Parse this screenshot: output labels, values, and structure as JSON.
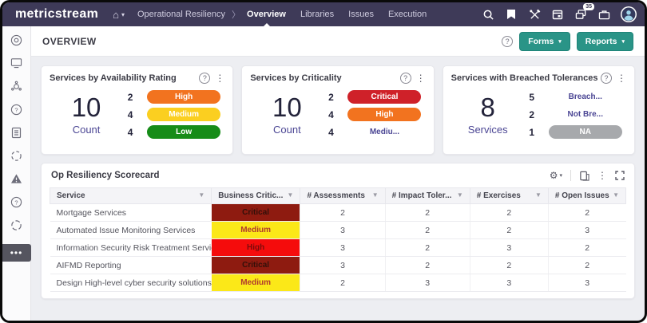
{
  "icons": {
    "home": "⌂",
    "caret": "▾",
    "chevron": "〉",
    "help": "?",
    "kebab": "⋮",
    "gear": "⚙",
    "sort": "▼",
    "more": "•••"
  },
  "topbar": {
    "logo": "metricstream",
    "breadcrumb_parent": "Operational Resiliency",
    "nav_active": "Overview",
    "nav_items": {
      "libraries": "Libraries",
      "issues": "Issues",
      "execution": "Execution"
    },
    "notification_badge": "35"
  },
  "page": {
    "title": "OVERVIEW",
    "forms_button": "Forms",
    "reports_button": "Reports"
  },
  "cards": [
    {
      "title": "Services by Availability Rating",
      "count": "10",
      "count_label": "Count",
      "rows": [
        {
          "value": "2",
          "label": "High",
          "bg": "#f2731f",
          "color": "#ffffff"
        },
        {
          "value": "4",
          "label": "Medium",
          "bg": "#fbcf20",
          "color": "#ffffff"
        },
        {
          "value": "4",
          "label": "Low",
          "bg": "#168c18",
          "color": "#ffffff"
        }
      ]
    },
    {
      "title": "Services by Criticality",
      "count": "10",
      "count_label": "Count",
      "rows": [
        {
          "value": "2",
          "label": "Critical",
          "bg": "#cf2129",
          "color": "#ffffff"
        },
        {
          "value": "4",
          "label": "High",
          "bg": "#f2731f",
          "color": "#ffffff"
        },
        {
          "value": "4",
          "label": "Mediu...",
          "bg": "transparent",
          "color": "#4b4694"
        }
      ]
    },
    {
      "title": "Services with Breached Tolerances",
      "count": "8",
      "count_label": "Services",
      "rows": [
        {
          "value": "5",
          "label": "Breach...",
          "bg": "transparent",
          "color": "#4b4694"
        },
        {
          "value": "2",
          "label": "Not Bre...",
          "bg": "transparent",
          "color": "#4b4694"
        },
        {
          "value": "1",
          "label": "NA",
          "bg": "#a7a9ac",
          "color": "#ffffff"
        }
      ]
    }
  ],
  "scorecard": {
    "title": "Op Resiliency Scorecard",
    "columns": [
      "Service",
      "Business Critic...",
      "# Assessments",
      "# Impact Toler...",
      "# Exercises",
      "# Open Issues"
    ],
    "rows": [
      {
        "service": "Mortgage Services",
        "criticality": "Critical",
        "crit_bg": "#8e1b10",
        "crit_color": "#33100a",
        "assessments": "2",
        "impact": "2",
        "exercises": "2",
        "open_issues": "2"
      },
      {
        "service": "Automated Issue Monitoring Services",
        "criticality": "Medium",
        "crit_bg": "#fbe818",
        "crit_color": "#b03a2e",
        "assessments": "3",
        "impact": "2",
        "exercises": "2",
        "open_issues": "3"
      },
      {
        "service": "Information Security Risk Treatment Service",
        "criticality": "High",
        "crit_bg": "#f50c0c",
        "crit_color": "#7c0b0b",
        "assessments": "3",
        "impact": "2",
        "exercises": "3",
        "open_issues": "2"
      },
      {
        "service": "AIFMD Reporting",
        "criticality": "Critical",
        "crit_bg": "#8e1b10",
        "crit_color": "#33100a",
        "assessments": "3",
        "impact": "2",
        "exercises": "2",
        "open_issues": "2"
      },
      {
        "service": "Design High-level cyber security solutions",
        "criticality": "Medium",
        "crit_bg": "#fbe818",
        "crit_color": "#b03a2e",
        "assessments": "2",
        "impact": "3",
        "exercises": "3",
        "open_issues": "3"
      }
    ]
  },
  "colors": {
    "topbar_bg": "#3e3a58",
    "accent_teal": "#2a9487",
    "accent_purple": "#4b4694",
    "content_bg": "#edeef2"
  }
}
